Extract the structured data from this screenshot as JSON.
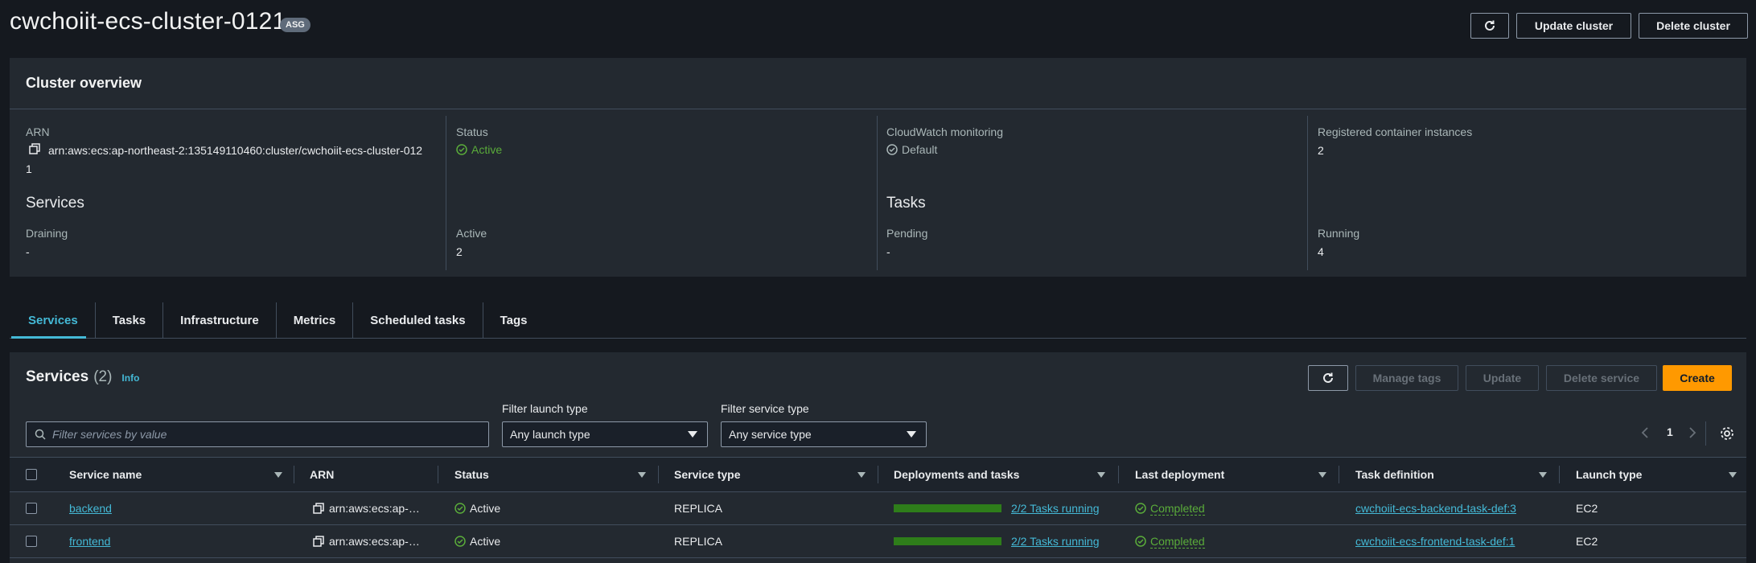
{
  "header": {
    "title": "cwchoiit-ecs-cluster-0121",
    "badge": "ASG",
    "update_label": "Update cluster",
    "delete_label": "Delete cluster"
  },
  "overview": {
    "title": "Cluster overview",
    "arn_label": "ARN",
    "arn_line1": "arn:aws:ecs:ap-northeast-2:135149110460:cluster/cwchoiit-ecs-cluster-012",
    "arn_line2": "1",
    "status_label": "Status",
    "status_value": "Active",
    "cloudwatch_label": "CloudWatch monitoring",
    "cloudwatch_value": "Default",
    "registered_label": "Registered container instances",
    "registered_value": "2",
    "services_title": "Services",
    "draining_label": "Draining",
    "draining_value": "-",
    "active_label": "Active",
    "active_value": "2",
    "tasks_title": "Tasks",
    "pending_label": "Pending",
    "pending_value": "-",
    "running_label": "Running",
    "running_value": "4"
  },
  "tabs": [
    "Services",
    "Tasks",
    "Infrastructure",
    "Metrics",
    "Scheduled tasks",
    "Tags"
  ],
  "services": {
    "title": "Services",
    "count": "(2)",
    "info": "Info",
    "manage_tags": "Manage tags",
    "update": "Update",
    "delete_service": "Delete service",
    "create": "Create",
    "filter_placeholder": "Filter services by value",
    "launch_type_label": "Filter launch type",
    "launch_type_value": "Any launch type",
    "service_type_label": "Filter service type",
    "service_type_value": "Any service type",
    "page": "1",
    "columns": [
      "Service name",
      "ARN",
      "Status",
      "Service type",
      "Deployments and tasks",
      "Last deployment",
      "Task definition",
      "Launch type"
    ],
    "rows": [
      {
        "name": "backend",
        "arn": "arn:aws:ecs:ap-…",
        "status": "Active",
        "type": "REPLICA",
        "tasks": "2/2 Tasks running",
        "deployment": "Completed",
        "task_def": "cwchoiit-ecs-backend-task-def:3",
        "launch": "EC2"
      },
      {
        "name": "frontend",
        "arn": "arn:aws:ecs:ap-…",
        "status": "Active",
        "type": "REPLICA",
        "tasks": "2/2 Tasks running",
        "deployment": "Completed",
        "task_def": "cwchoiit-ecs-frontend-task-def:1",
        "launch": "EC2"
      }
    ]
  },
  "colors": {
    "accent": "#44b9d6",
    "success": "#5aac3a",
    "primary_button": "#ff9900"
  }
}
